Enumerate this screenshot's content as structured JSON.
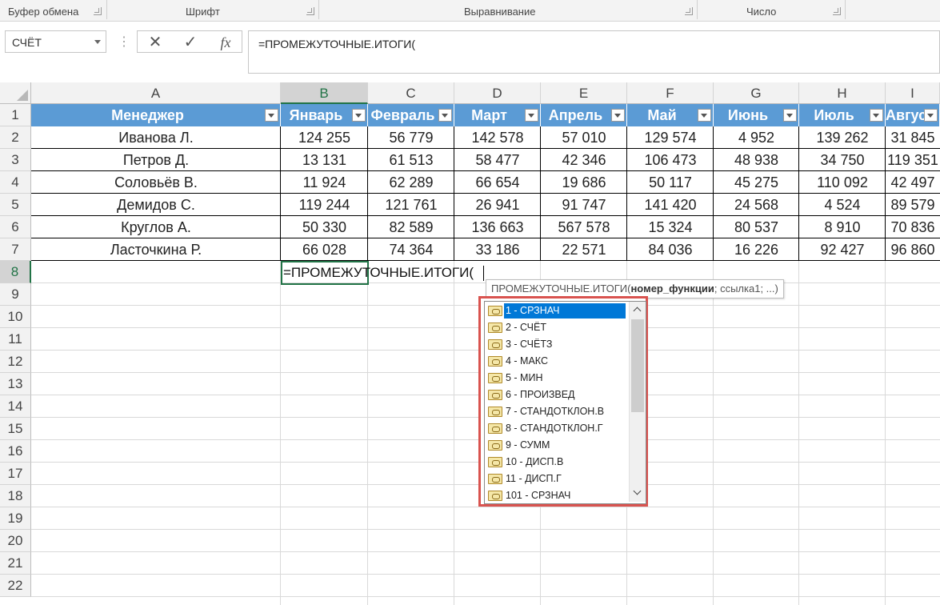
{
  "ribbon": {
    "groups": [
      {
        "label": "Буфер обмена"
      },
      {
        "label": "Шрифт"
      },
      {
        "label": "Выравнивание"
      },
      {
        "label": "Число"
      }
    ]
  },
  "formula_bar": {
    "name_box": "СЧЁТ",
    "cancel_icon": "✕",
    "enter_icon": "✓",
    "fx_label": "fx",
    "formula": "=ПРОМЕЖУТОЧНЫЕ.ИТОГИ("
  },
  "columns": [
    "A",
    "B",
    "C",
    "D",
    "E",
    "F",
    "G",
    "H",
    "I"
  ],
  "rows": [
    "1",
    "2",
    "3",
    "4",
    "5",
    "6",
    "7",
    "8",
    "9",
    "10",
    "11",
    "12",
    "13",
    "14",
    "15",
    "16",
    "17",
    "18",
    "19",
    "20",
    "21",
    "22"
  ],
  "table": {
    "headers": [
      "Менеджер",
      "Январь",
      "Февраль",
      "Март",
      "Апрель",
      "Май",
      "Июнь",
      "Июль",
      "Август"
    ],
    "rows": [
      [
        "Иванова Л.",
        "124 255",
        "56 779",
        "142 578",
        "57 010",
        "129 574",
        "4 952",
        "139 262",
        "31 845"
      ],
      [
        "Петров Д.",
        "13 131",
        "61 513",
        "58 477",
        "42 346",
        "106 473",
        "48 938",
        "34 750",
        "119 351"
      ],
      [
        "Соловьёв В.",
        "11 924",
        "62 289",
        "66 654",
        "19 686",
        "50 117",
        "45 275",
        "110 092",
        "42 497"
      ],
      [
        "Демидов С.",
        "119 244",
        "121 761",
        "26 941",
        "91 747",
        "141 420",
        "24 568",
        "4 524",
        "89 579"
      ],
      [
        "Круглов А.",
        "50 330",
        "82 589",
        "136 663",
        "567 578",
        "15 324",
        "80 537",
        "8 910",
        "70 836"
      ],
      [
        "Ласточкина Р.",
        "66 028",
        "74 364",
        "33 186",
        "22 571",
        "84 036",
        "16 226",
        "92 427",
        "96 860"
      ]
    ]
  },
  "edit_cell": {
    "text": "=ПРОМЕЖУТОЧНЫЕ.ИТОГИ("
  },
  "tooltip": {
    "fn": "ПРОМЕЖУТОЧНЫЕ.ИТОГИ(",
    "arg_bold": "номер_функции",
    "rest": "; ссылка1; ...)"
  },
  "autocomplete": {
    "items": [
      "1 - СРЗНАЧ",
      "2 - СЧЁТ",
      "3 - СЧЁТЗ",
      "4 - МАКС",
      "5 - МИН",
      "6 - ПРОИЗВЕД",
      "7 - СТАНДОТКЛОН.В",
      "8 - СТАНДОТКЛОН.Г",
      "9 - СУММ",
      "10 - ДИСП.В",
      "11 - ДИСП.Г",
      "101 - СРЗНАЧ"
    ],
    "selected_index": 0
  },
  "colors": {
    "table_header": "#5b9bd5",
    "selection": "#217346",
    "highlight": "#0078d7",
    "callout_border": "#d9534f"
  }
}
